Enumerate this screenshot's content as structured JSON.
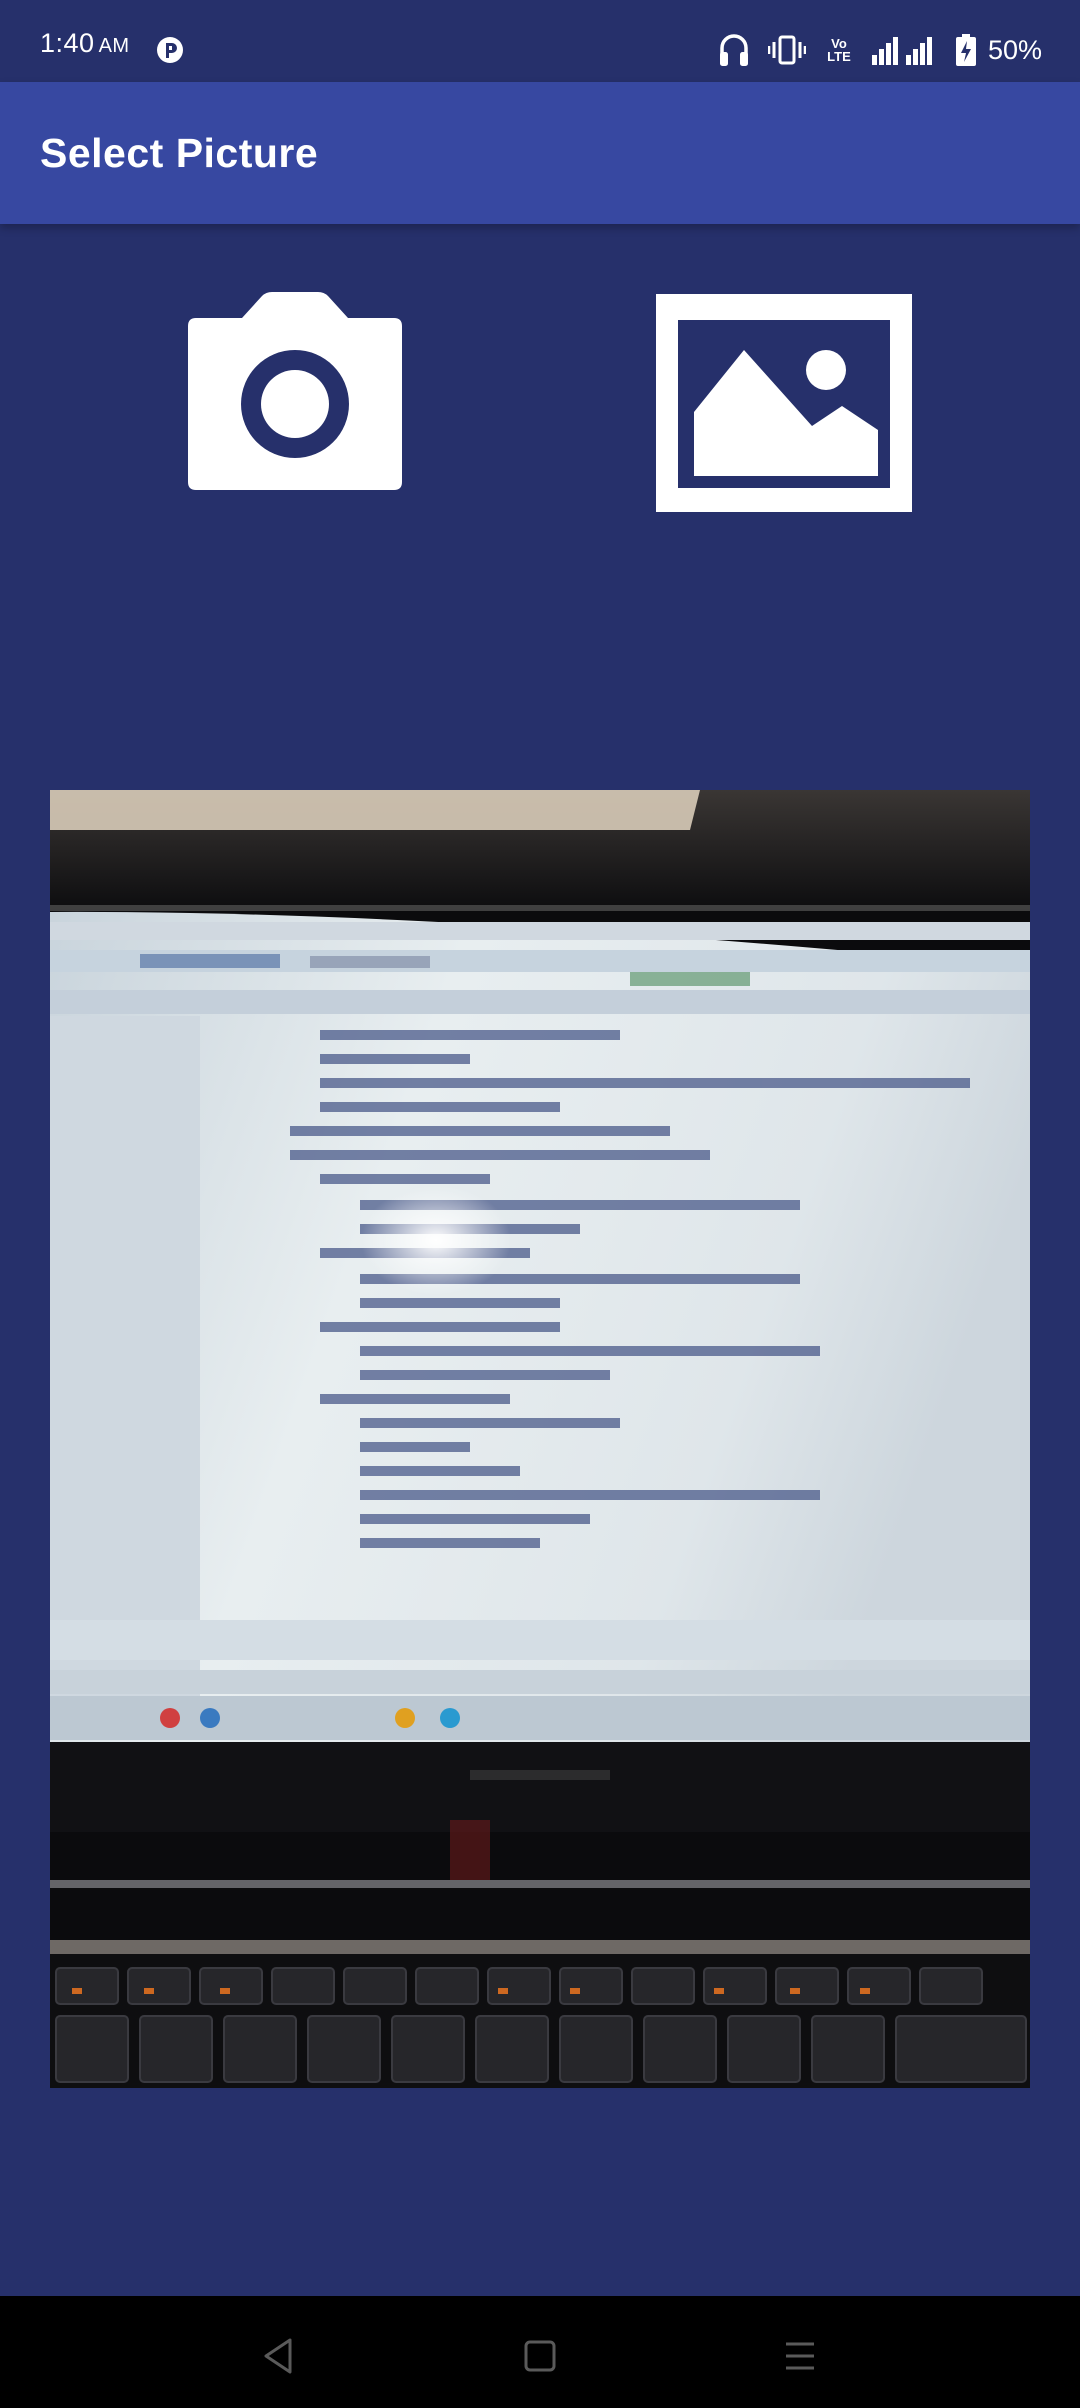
{
  "status_bar": {
    "time": "1:40",
    "ampm": "AM",
    "volte_line1": "Vo",
    "volte_line2": "LTE",
    "battery": "50%"
  },
  "app_bar": {
    "title": "Select Picture"
  },
  "actions": {
    "camera_icon": "camera-icon",
    "gallery_icon": "image-icon"
  },
  "preview": {
    "icon": "photo-preview"
  },
  "nav": {
    "back_icon": "back-triangle-icon",
    "home_icon": "home-square-icon",
    "recents_icon": "menu-lines-icon"
  },
  "colors": {
    "background": "#26306b",
    "app_bar": "#3748a1",
    "icon": "#ffffff"
  }
}
